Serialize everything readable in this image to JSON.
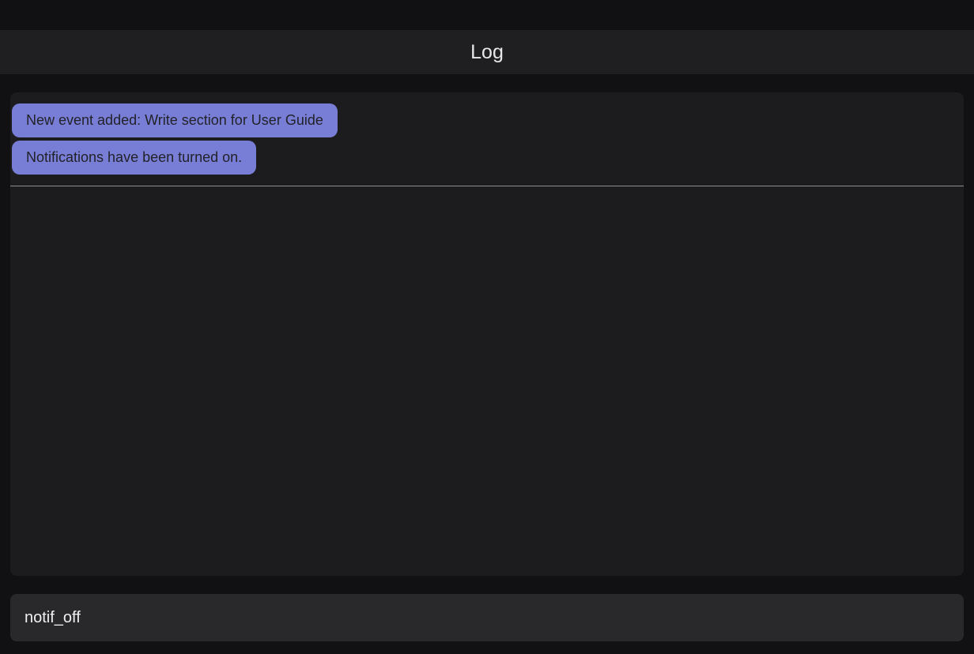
{
  "header": {
    "title": "Log"
  },
  "log": {
    "entries": [
      "New event added: Write section for User Guide",
      "Notifications have been turned on."
    ]
  },
  "input": {
    "value": "notif_off"
  }
}
